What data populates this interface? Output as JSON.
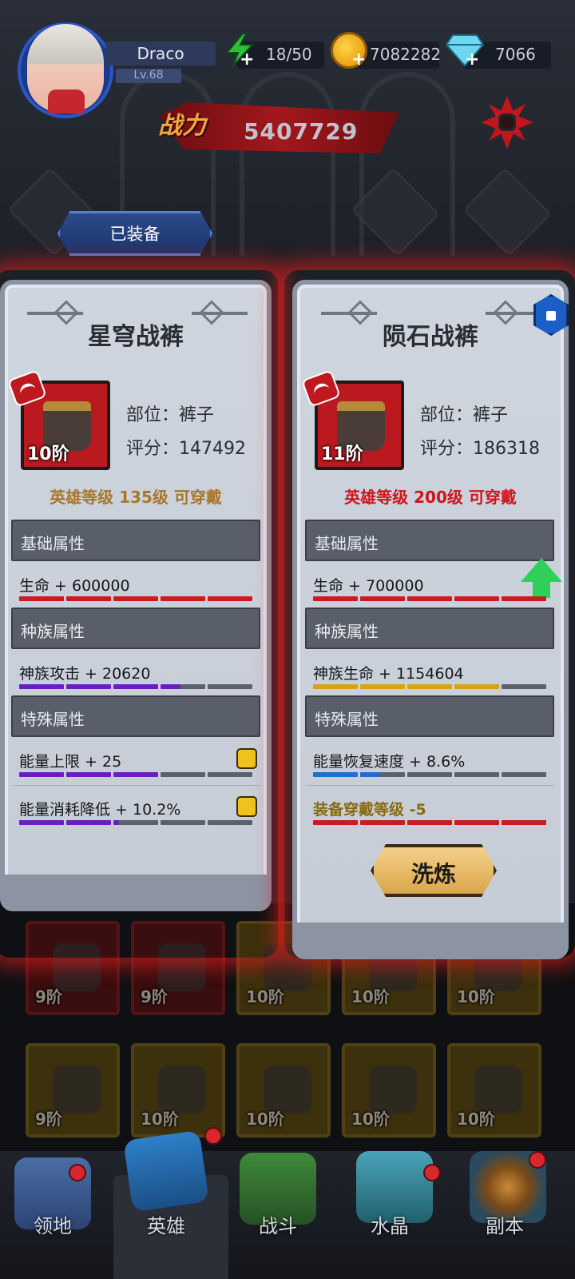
{
  "header": {
    "player_name": "Draco",
    "level": "Lv.68",
    "energy": "18/50",
    "coins": "7082282",
    "gems": "7066",
    "power_label": "战力",
    "power_value": "5407729",
    "equipped_tab": "已装备"
  },
  "left_card": {
    "title": "星穹战裤",
    "tier": "10阶",
    "slot_line": "部位：裤子",
    "score_line": "评分：147492",
    "requirement": "英雄等级  135级  可穿戴",
    "sections": {
      "basic": "基础属性",
      "race": "种族属性",
      "special": "特殊属性"
    },
    "stats": {
      "basic": "生命 + 600000",
      "race": "神族攻击 + 20620",
      "special_1": "能量上限 + 25",
      "special_2": "能量消耗降低 + 10.2%"
    }
  },
  "right_card": {
    "title": "陨石战裤",
    "tier": "11阶",
    "slot_line": "部位：裤子",
    "score_line": "评分：186318",
    "requirement": "英雄等级  200级  可穿戴",
    "sections": {
      "basic": "基础属性",
      "race": "种族属性",
      "special": "特殊属性"
    },
    "stats": {
      "basic": "生命 + 700000",
      "race": "神族生命 + 1154604",
      "special_1": "能量恢复速度 + 8.6%",
      "special_2": "装备穿戴等级  -5"
    },
    "refine_button": "洗炼"
  },
  "inventory": {
    "row1": [
      "9阶",
      "9阶",
      "10阶",
      "10阶",
      "10阶"
    ],
    "row2": [
      "9阶",
      "10阶",
      "10阶",
      "10阶",
      "10阶"
    ]
  },
  "nav": {
    "items": [
      "领地",
      "英雄",
      "战斗",
      "水晶",
      "副本"
    ]
  },
  "colors": {
    "requirement_ok": "#a8762a",
    "requirement_bad": "#d0151b",
    "rarity_red": "#b9191f",
    "card_glow": "#dc1e1e"
  }
}
